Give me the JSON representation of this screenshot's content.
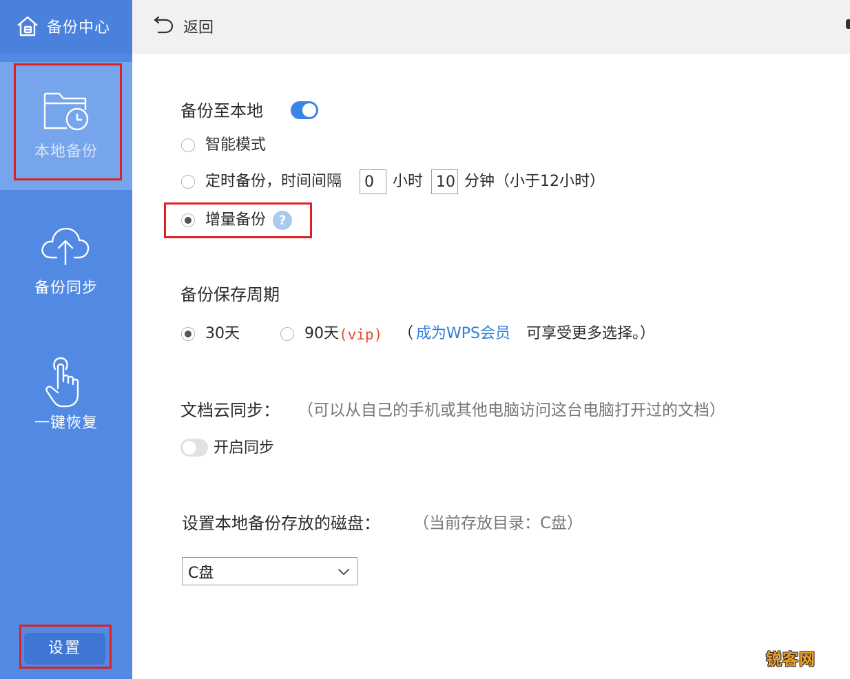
{
  "sidebar": {
    "app_title": "备份中心",
    "items": [
      {
        "label": "本地备份",
        "icon": "folder-clock-icon",
        "active": true
      },
      {
        "label": "备份同步",
        "icon": "cloud-upload-icon",
        "active": false
      },
      {
        "label": "一键恢复",
        "icon": "hand-pointer-icon",
        "active": false
      }
    ],
    "settings_label": "设置"
  },
  "topbar": {
    "back_label": "返回"
  },
  "local_backup": {
    "title": "备份至本地",
    "enabled": true,
    "modes": {
      "smart": "智能模式",
      "timed_prefix": "定时备份，时间间隔",
      "hours_value": "0",
      "hours_unit": "小时",
      "minutes_value": "10",
      "minutes_unit": "分钟（小于12小时）",
      "incremental": "增量备份",
      "selected": "incremental"
    }
  },
  "retention": {
    "title": "备份保存周期",
    "option_30": "30天",
    "option_90": "90天",
    "vip_tag": "(vip)",
    "open_paren": "（",
    "link": "成为WPS会员",
    "suffix": "可享受更多选择。）",
    "selected": "30"
  },
  "cloud_sync": {
    "title": "文档云同步：",
    "description": "（可以从自己的手机或其他电脑访问这台电脑打开过的文档）",
    "toggle_label": "开启同步",
    "enabled": false
  },
  "disk": {
    "title": "设置本地备份存放的磁盘：",
    "current": "（当前存放目录：C盘）",
    "selected": "C盘"
  },
  "watermark": "锐客网",
  "colors": {
    "sidebar_bg": "#5289e2",
    "sidebar_active": "#77a5eb",
    "accent": "#3a86e6",
    "link": "#2f7fd8",
    "highlight_box": "#e02020",
    "vip": "#e34b2c"
  }
}
